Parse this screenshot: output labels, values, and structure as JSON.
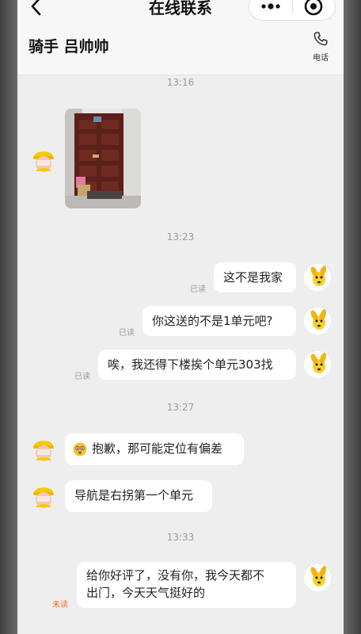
{
  "nav": {
    "title": "在线联系"
  },
  "header": {
    "rider": "骑手 吕帅帅",
    "call_label": "电话"
  },
  "times": [
    "13:16",
    "13:23",
    "13:27",
    "13:33"
  ],
  "messages": {
    "m1": "这不是我家",
    "m2": "你这送的不是1单元吧?",
    "m3": "唉，我还得下楼挨个单元303找",
    "m4": "抱歉，那可能定位有偏差",
    "m5": "导航是右拐第一个单元",
    "m6_line1": "给你好评了，没有你，我今天都不",
    "m6_line2": "出门，今天天气挺好的"
  },
  "status": {
    "read": "已读",
    "unread": "未读"
  },
  "colors": {
    "bubble": "#ffffff",
    "background": "#eeeeee",
    "unread": "#f26b2a"
  },
  "icons": [
    "back-icon",
    "more-icon",
    "target-icon",
    "phone-icon",
    "rider-avatar-icon",
    "user-avatar-icon"
  ]
}
